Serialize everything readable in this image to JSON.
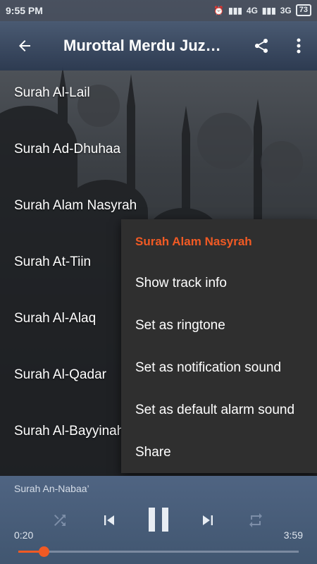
{
  "status_bar": {
    "time": "9:55 PM",
    "network1": "4G",
    "network2": "3G",
    "battery": "73"
  },
  "app_bar": {
    "title": "Murottal Merdu Juz…"
  },
  "track_list": [
    {
      "label": "Surah Al-Lail"
    },
    {
      "label": "Surah Ad-Dhuhaa"
    },
    {
      "label": "Surah Alam Nasyrah"
    },
    {
      "label": "Surah At-Tiin"
    },
    {
      "label": "Surah Al-Alaq"
    },
    {
      "label": "Surah Al-Qadar"
    },
    {
      "label": "Surah Al-Bayyinah"
    }
  ],
  "context_menu": {
    "header": "Surah Alam Nasyrah",
    "items": [
      {
        "label": "Show track info"
      },
      {
        "label": "Set as ringtone"
      },
      {
        "label": "Set as notification sound"
      },
      {
        "label": "Set as default alarm sound"
      },
      {
        "label": "Share"
      }
    ]
  },
  "player": {
    "now_playing": "Surah An-Nabaa’",
    "current_time": "0:20",
    "total_time": "3:59",
    "progress": 0.09,
    "accent_color": "#f15a24"
  }
}
